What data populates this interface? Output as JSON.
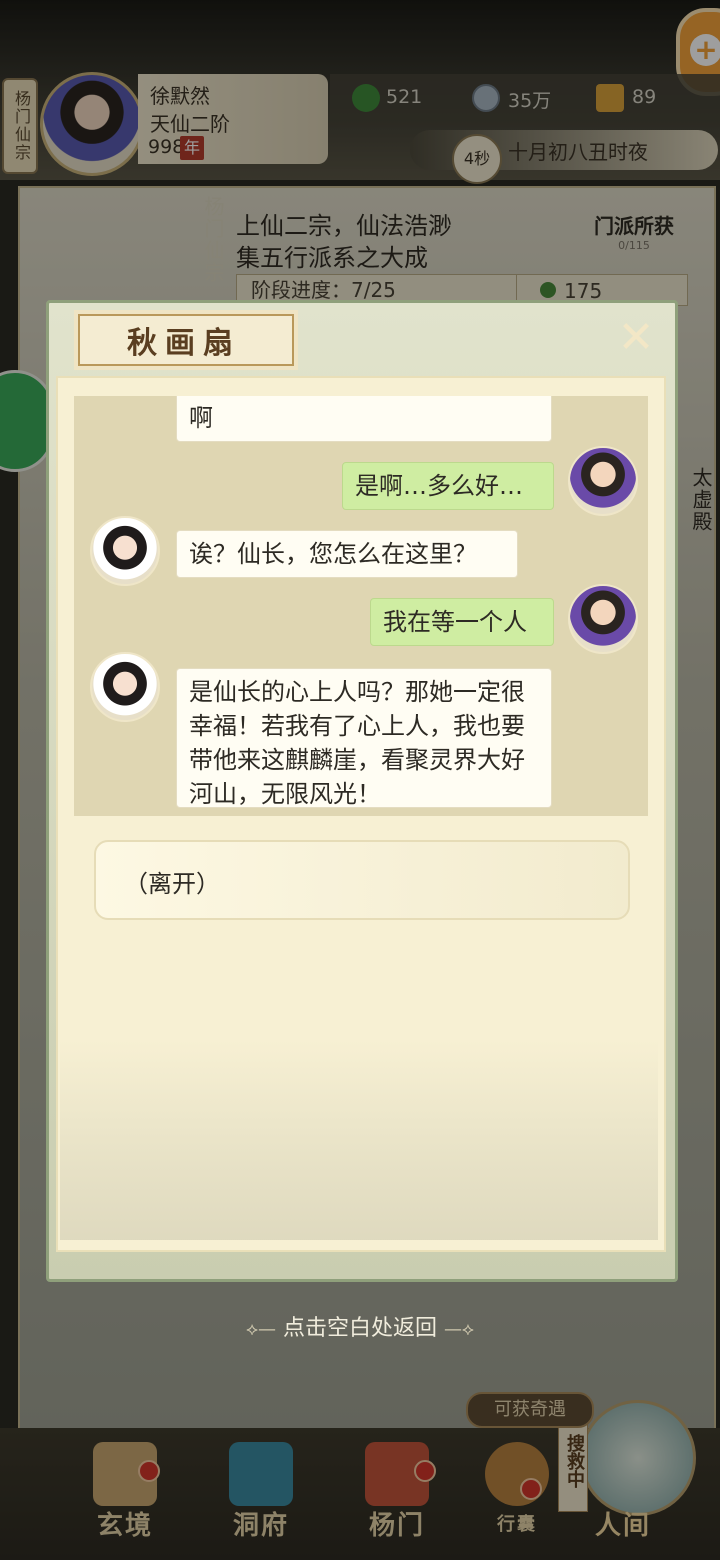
{
  "header": {
    "sect_tag": "杨门仙宗",
    "player": {
      "name": "徐默然",
      "rank": "天仙二阶",
      "age": "998",
      "age_unit": "年"
    },
    "resources": [
      {
        "icon": "jade-leaf-icon",
        "value": "521",
        "color": "#3f8a3a"
      },
      {
        "icon": "coin-icon",
        "value": "35万",
        "color": "#a9b6c2"
      },
      {
        "icon": "trophy-icon",
        "value": "89",
        "color": "#d8a23a"
      }
    ],
    "timer": "4秒",
    "date": "十月初八丑时夜"
  },
  "background_panel": {
    "sect_label": "杨门仙宗",
    "desc_line1": "上仙二宗，仙法浩渺",
    "desc_line2": "集五行派系之大成",
    "reward_title": "门派所获",
    "reward_count": "0/115",
    "progress": "阶段进度：7/25",
    "jade": "175",
    "right_label": "太虚殿"
  },
  "dialog": {
    "title": "秋画扇",
    "messages": [
      {
        "speaker": "npc",
        "text": "啊"
      },
      {
        "speaker": "player",
        "text": "是啊…多么好…"
      },
      {
        "speaker": "npc",
        "text": "诶？仙长，您怎么在这里？"
      },
      {
        "speaker": "player",
        "text": "我在等一个人"
      },
      {
        "speaker": "npc",
        "text": "是仙长的心上人吗？那她一定很幸福！若我有了心上人，我也要带他来这麒麟崖，看聚灵界大好河山，无限风光！"
      }
    ],
    "choice": "（离开）"
  },
  "back_hint": "点击空白处返回",
  "bottom_nav": {
    "loot_tag": "可获奇遇",
    "search_tag": "搜救中",
    "items": [
      {
        "label": "玄境",
        "icon": "scroll-icon",
        "badge": true
      },
      {
        "label": "洞府",
        "icon": "pavilion-icon",
        "badge": false
      },
      {
        "label": "杨门",
        "icon": "banner-icon",
        "badge": true
      },
      {
        "label": "行囊",
        "icon": "bag-icon",
        "badge": true
      },
      {
        "label": "人间",
        "icon": "world-icon",
        "badge": false
      }
    ]
  }
}
